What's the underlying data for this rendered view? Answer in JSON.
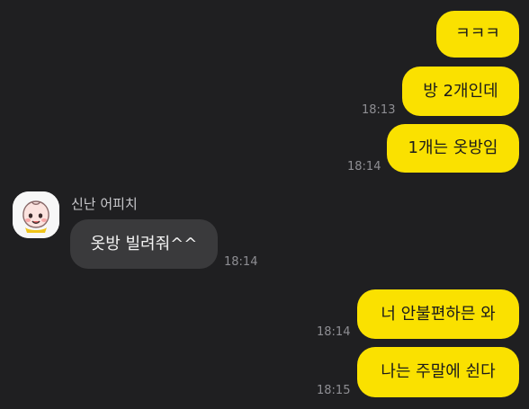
{
  "contact": {
    "name": "신난 어피치",
    "avatar_icon": "apeach-avatar-icon"
  },
  "messages": [
    {
      "sender": "me",
      "text": "ㅋㅋㅋ",
      "time": ""
    },
    {
      "sender": "me",
      "text": "방 2개인데",
      "time": "18:13"
    },
    {
      "sender": "me",
      "text": "1개는 옷방임",
      "time": "18:14"
    },
    {
      "sender": "other",
      "text": "옷방 빌려줘^^",
      "time": "18:14"
    },
    {
      "sender": "me",
      "text": "너 안불편하믄 와",
      "time": "18:14"
    },
    {
      "sender": "me",
      "text": "나는 주말에 쉰다",
      "time": "18:15"
    }
  ],
  "colors": {
    "background": "#1f1f21",
    "my_bubble": "#fae100",
    "other_bubble": "#3a3a3c",
    "time_text": "#8e8e93"
  }
}
